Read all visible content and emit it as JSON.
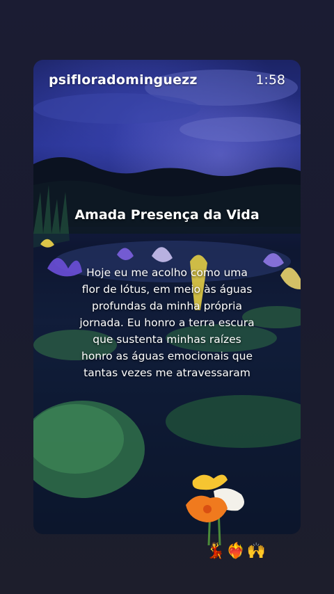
{
  "header": {
    "username": "psifloradominguezz",
    "time": "1:58"
  },
  "content": {
    "title": "Amada Presença da Vida",
    "lines": [
      "Hoje eu me acolho como uma",
      "flor de lótus, em meio às águas",
      "profundas da minha própria",
      "jornada. Eu honro a terra escura",
      "que sustenta minhas raízes",
      "honro as águas emocionais que",
      "tantas vezes me atravessaram"
    ]
  },
  "reactions": {
    "emojis": "💃❤️‍🔥🙌"
  },
  "colors": {
    "background": "#1a1b2f",
    "text": "#ffffff",
    "lotus_purple": "#6b4fd8",
    "lotus_yellow": "#f2d64b",
    "leaf_green": "#2f6b4a"
  }
}
